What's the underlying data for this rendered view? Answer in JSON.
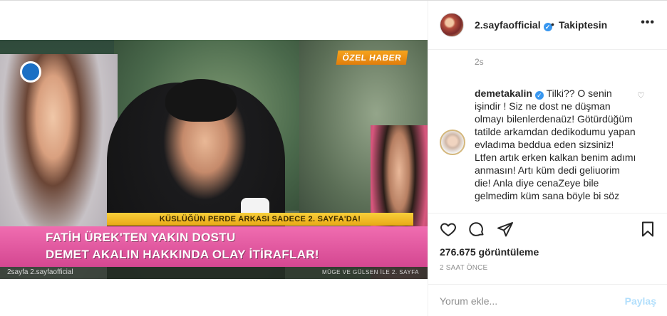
{
  "video": {
    "badge": "ÖZEL HABER",
    "strip_text": "KÜSLÜĞÜN PERDE ARKASI SADECE 2. SAYFA'DA!",
    "headline_line1": "FATİH ÜREK'TEN YAKIN DOSTU",
    "headline_line2": "DEMET AKALIN HAKKINDA OLAY İTİRAFLAR!",
    "footer_left": "2sayfa   2.sayfaofficial",
    "footer_right": "MÜGE VE GÜLSEN İLE 2. SAYFA",
    "colors": {
      "banner": "#e05aa3",
      "badge": "#f09a1a",
      "strip": "#f2bf2c"
    }
  },
  "header": {
    "username": "2.sayfaofficial",
    "separator": "•",
    "follow_status": "Takiptesin",
    "more": "•••",
    "verified_icon": "verified-badge-icon"
  },
  "comments": {
    "time_top": "2s",
    "comment": {
      "username": "demetakalin",
      "text": "Tilki?? O senin işindir ! Siz ne dost ne düşman olmayı bilenlerdenaüz! Götürdüğüm tatilde arkamdan dedikodumu yapan evladıma beddua eden sizsiniz! Ltfen artık erken kalkan benim adımı anmasın! Artı küm dedi geliuorim die! Anla diye cenaZeye bile gelmedim küm sana böyle bi söz"
    }
  },
  "stats": {
    "views": "276.675 görüntüleme",
    "time_ago": "2 SAAT ÖNCE"
  },
  "add_comment": {
    "placeholder": "Yorum ekle...",
    "post_label": "Paylaş"
  }
}
